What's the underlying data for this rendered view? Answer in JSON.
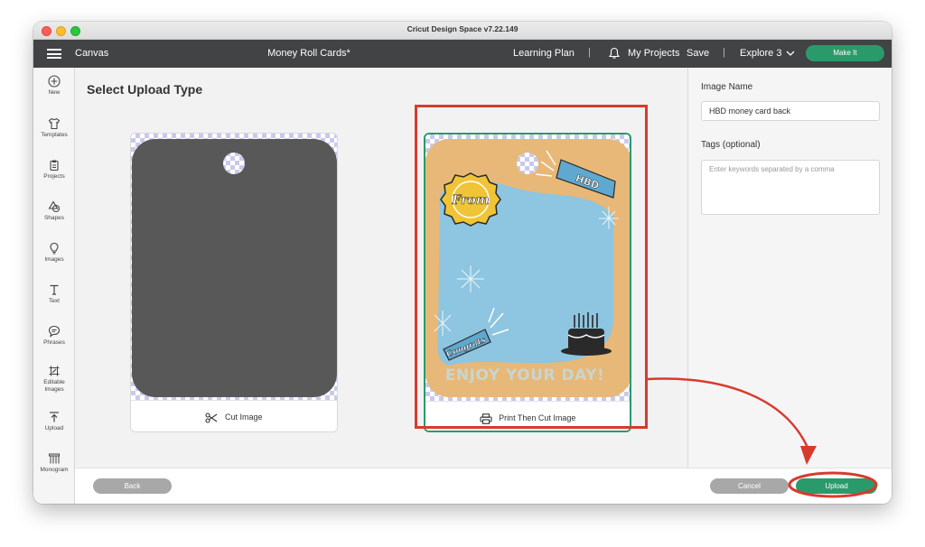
{
  "window": {
    "title": "Cricut Design Space  v7.22.149"
  },
  "appbar": {
    "canvas_label": "Canvas",
    "project_name": "Money Roll Cards*",
    "learning_plan": "Learning Plan",
    "my_projects": "My Projects",
    "save": "Save",
    "machine": "Explore 3",
    "make_it": "Make It"
  },
  "sidebar": {
    "items": [
      {
        "label": "New",
        "icon": "plus-circle-icon"
      },
      {
        "label": "Templates",
        "icon": "shirt-icon"
      },
      {
        "label": "Projects",
        "icon": "clipboard-icon"
      },
      {
        "label": "Shapes",
        "icon": "shapes-icon"
      },
      {
        "label": "Images",
        "icon": "lightbulb-icon"
      },
      {
        "label": "Text",
        "icon": "text-icon"
      },
      {
        "label": "Phrases",
        "icon": "speech-bubble-icon"
      },
      {
        "label": "Editable Images",
        "icon": "editable-image-icon"
      },
      {
        "label": "Upload",
        "icon": "upload-icon"
      },
      {
        "label": "Monogram",
        "icon": "monogram-icon"
      }
    ]
  },
  "main": {
    "title": "Select Upload Type",
    "options": [
      {
        "label": "Cut Image",
        "icon": "scissors-icon",
        "selected": false
      },
      {
        "label": "Print Then Cut Image",
        "icon": "printer-icon",
        "selected": true
      }
    ]
  },
  "card_art": {
    "from": "From",
    "hbd": "HBD",
    "congrats": "Congrats",
    "enjoy": "ENJOY YOUR DAY!"
  },
  "panel": {
    "image_name_label": "Image Name",
    "image_name_value": "HBD money card back",
    "tags_label": "Tags (optional)",
    "tags_placeholder": "Enter keywords separated by a comma"
  },
  "footer": {
    "back": "Back",
    "cancel": "Cancel",
    "upload": "Upload"
  },
  "colors": {
    "accent_green": "#2b9a6b",
    "annotation_red": "#d83a2e",
    "appbar_dark": "#414345"
  }
}
